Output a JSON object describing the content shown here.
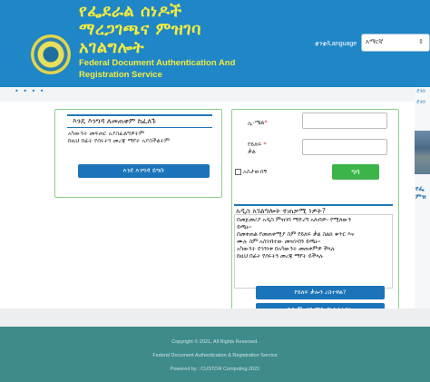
{
  "header": {
    "title_am_1": "የፌደራል ሰነዶች",
    "title_am_2": "ማረጋገጫና ምዝገባ",
    "title_am_3": "አገልግሎት",
    "title_en_1": "Federal Document Authentication And",
    "title_en_2": "Registration Service",
    "language_label": "ቋንቋ/Language",
    "language_selected": "አማርኛ"
  },
  "subbar": {
    "dots": "• • • •"
  },
  "right_strip": {
    "text1": "ደንበ",
    "text2": "ደንበ",
    "bold1": "የፌ",
    "bold2": "ምዝ"
  },
  "new_user": {
    "title": "እንዴ እንግዳ ለመጠቀም ከፈለጉ",
    "line1": "አካውንት መፍጠር አያስፈልግዎትም",
    "line2": "ከዚህ በፊት የሰሩትን መረጃ ማየት አያስችልትም",
    "button": "እንደ እንግዳ ይግቡ"
  },
  "login": {
    "email_label": "ኢ-ሜል",
    "email_value": "",
    "password_label_1": "የይለፍ",
    "password_label_2": "ቃል",
    "password_value": "",
    "remember_label": "አስታውሰኝ",
    "login_button": "ግባ"
  },
  "register_info": {
    "title": "አዲስ አገልግሎት ተጠቃሚ ነዎት?",
    "line1": "በመጀመሪያ አዲስ ምዝገባ ማድረግ አለብዎ። የሚለውን",
    "line2": "ይጫኑ።",
    "line3": "በመቀጠል የመጠቀሚያ ስም የይለፍ ቃል ስልክ ቁጥር እና",
    "line4": "ሙሉ ስም አስገብተው መዝገብን ይጫኑ።",
    "line5": "አካውንት ደኅንነቱ በአካውንት መጠቀምዎ ችላሉ",
    "line6": "ከዚህ በፊት የሰሩትን መረጃ ማየት ይችላሉ",
    "forgot_button": "የይለፍ ቃሎን ረስተዋል?",
    "register_button": "አዲስ ምዝገባ ማድረግ እፈልጋለው"
  },
  "footer": {
    "copyright": "Copyright © 2021, All Rights Reserved.",
    "org": "Federal Document Authentication & Registration Service",
    "powered": "Powered by : CUSTOR Computing 2021"
  },
  "colors": {
    "header_bg": "#1f86c8",
    "title_yellow": "#f2ec3f",
    "button_blue": "#1b74b9",
    "button_green": "#3db44a",
    "footer_bg": "#3f8b8c"
  }
}
